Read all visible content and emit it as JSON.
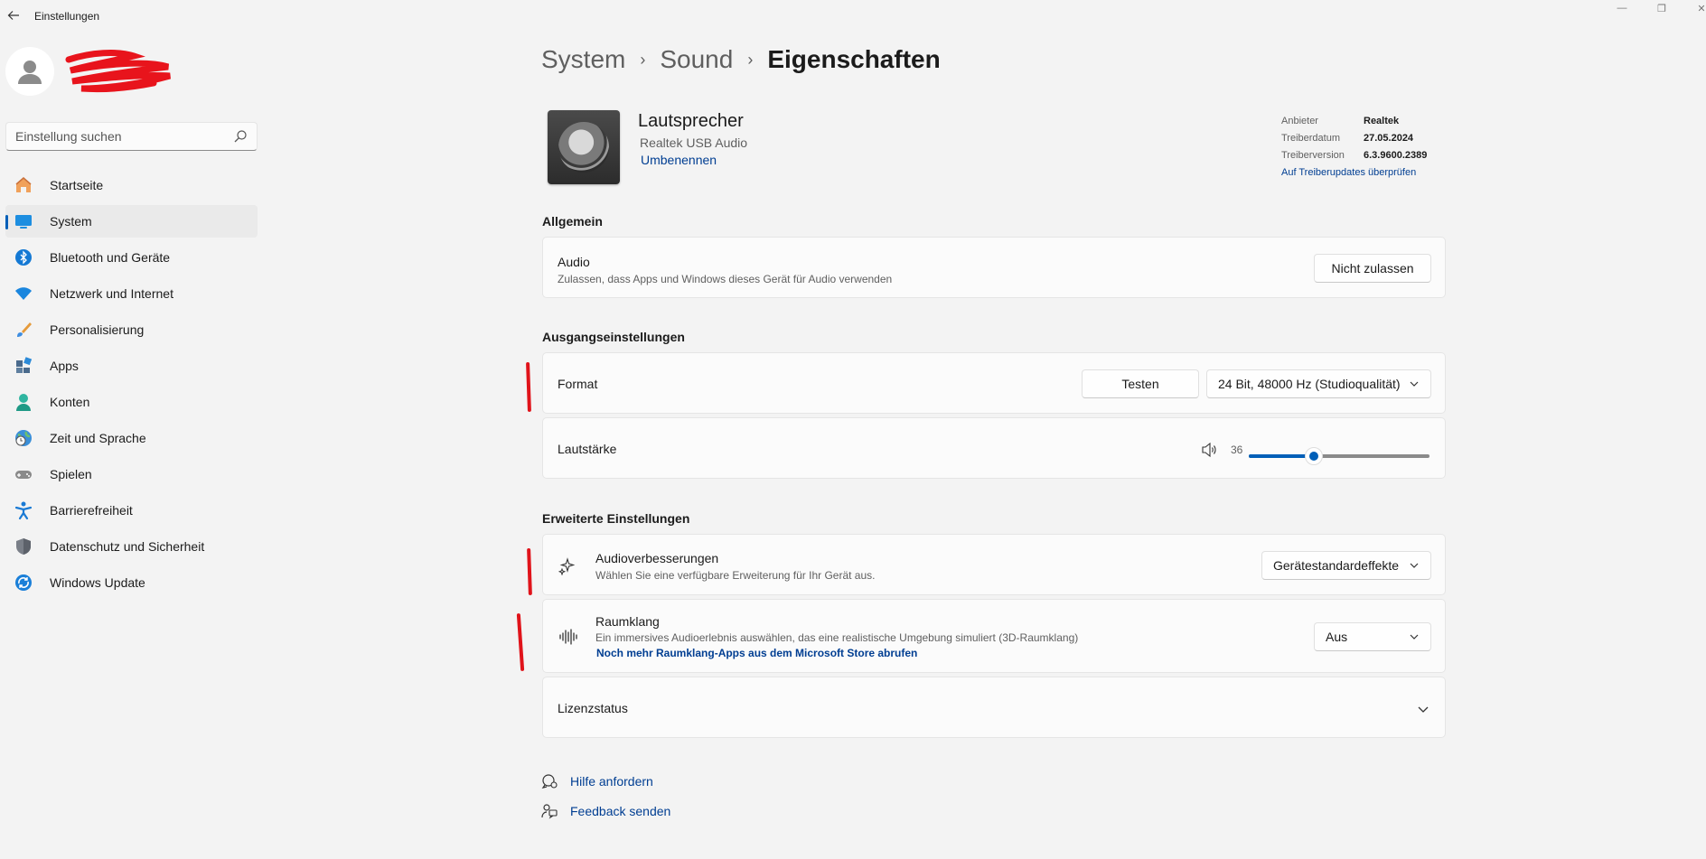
{
  "window": {
    "title": "Einstellungen",
    "back_icon": "back-arrow-icon",
    "minimize_glyph": "—",
    "maximize_glyph": "❐",
    "close_glyph": "✕"
  },
  "sidebar": {
    "search": {
      "placeholder": "Einstellung suchen",
      "value": ""
    },
    "items": [
      {
        "label": "Startseite",
        "icon": "home-icon"
      },
      {
        "label": "System",
        "icon": "system-icon",
        "active": true
      },
      {
        "label": "Bluetooth und Geräte",
        "icon": "bluetooth-icon"
      },
      {
        "label": "Netzwerk und Internet",
        "icon": "wifi-icon"
      },
      {
        "label": "Personalisierung",
        "icon": "brush-icon"
      },
      {
        "label": "Apps",
        "icon": "apps-icon"
      },
      {
        "label": "Konten",
        "icon": "account-icon"
      },
      {
        "label": "Zeit und Sprache",
        "icon": "globe-clock-icon"
      },
      {
        "label": "Spielen",
        "icon": "gamepad-icon"
      },
      {
        "label": "Barrierefreiheit",
        "icon": "accessibility-icon"
      },
      {
        "label": "Datenschutz und Sicherheit",
        "icon": "shield-icon"
      },
      {
        "label": "Windows Update",
        "icon": "update-icon"
      }
    ]
  },
  "breadcrumb": {
    "items": [
      "System",
      "Sound",
      "Eigenschaften"
    ],
    "separator": "›"
  },
  "device": {
    "name": "Lautsprecher",
    "subtitle": "Realtek USB Audio",
    "rename_label": "Umbenennen"
  },
  "driver_info": {
    "rows": [
      {
        "key": "Anbieter",
        "value": "Realtek"
      },
      {
        "key": "Treiberdatum",
        "value": "27.05.2024"
      },
      {
        "key": "Treiberversion",
        "value": "6.3.9600.2389"
      }
    ],
    "update_link": "Auf Treiberupdates überprüfen"
  },
  "sections": {
    "general": {
      "heading": "Allgemein",
      "audio": {
        "title": "Audio",
        "description": "Zulassen, dass Apps und Windows dieses Gerät für Audio verwenden",
        "button": "Nicht zulassen"
      }
    },
    "output": {
      "heading": "Ausgangseinstellungen",
      "format": {
        "title": "Format",
        "test_button": "Testen",
        "selected": "24 Bit, 48000 Hz (Studioqualität)"
      },
      "volume": {
        "title": "Lautstärke",
        "value": "36",
        "level": 0.36
      }
    },
    "advanced": {
      "heading": "Erweiterte Einstellungen",
      "enhancements": {
        "title": "Audioverbesserungen",
        "description": "Wählen Sie eine verfügbare Erweiterung für Ihr Gerät aus.",
        "selected": "Gerätestandardeffekte"
      },
      "spatial": {
        "title": "Raumklang",
        "description": "Ein immersives Audioerlebnis auswählen, das eine realistische Umgebung simuliert (3D-Raumklang)",
        "link": "Noch mehr Raumklang-Apps aus dem Microsoft Store abrufen",
        "selected": "Aus"
      },
      "license": {
        "title": "Lizenzstatus"
      }
    }
  },
  "footer": {
    "help": "Hilfe anfordern",
    "feedback": "Feedback senden"
  },
  "colors": {
    "accent": "#005fb8",
    "link": "#003e92",
    "annotation_marker": "#e0131a",
    "background": "#f3f3f3",
    "card": "#fbfbfb"
  }
}
